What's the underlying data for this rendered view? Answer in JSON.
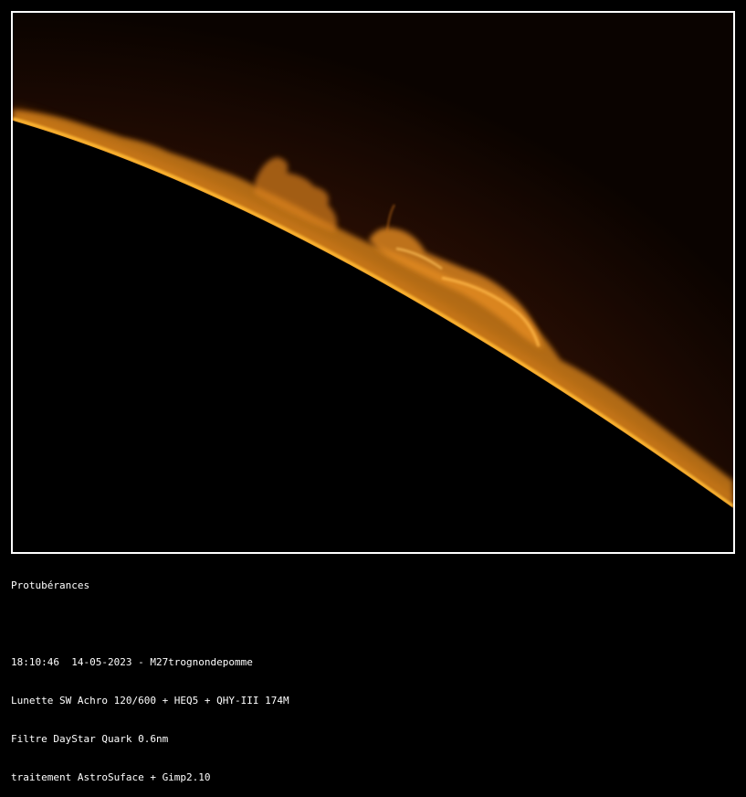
{
  "caption": {
    "title": "Protubérances",
    "line1": "18:10:46  14-05-2023 - M27trognondepomme",
    "line2": "Lunette SW Achro 120/600 + HEQ5 + QHY-III 174M",
    "line3": "Filtre DayStar Quark 0.6nm",
    "line4": "traitement AstroSuface + Gimp2.10"
  },
  "colors": {
    "background": "#000000",
    "frame": "#ffffff",
    "limb": "#ffb733",
    "prominence": "#e88a1e",
    "sky_glow": "#3a1505"
  }
}
